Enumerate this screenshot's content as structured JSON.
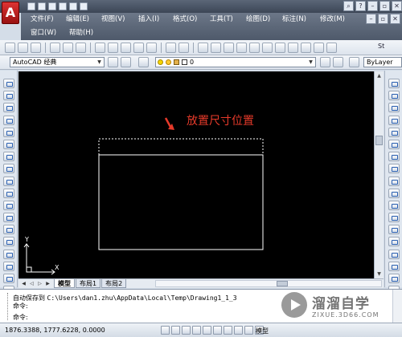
{
  "app": {
    "logo_letter": "A"
  },
  "menubar": {
    "row1": [
      "文件(F)",
      "编辑(E)",
      "视图(V)",
      "插入(I)",
      "格式(O)",
      "工具(T)",
      "绘图(D)",
      "标注(N)",
      "修改(M)"
    ],
    "row2": [
      "窗口(W)",
      "帮助(H)"
    ]
  },
  "toolbar": {
    "workspace": "AutoCAD 经典",
    "layer": "0",
    "linetype_combo": "ByLayer",
    "text_style_label": "St"
  },
  "annotation": {
    "text": "放置尺寸位置",
    "color": "#e63a2a"
  },
  "tabs": [
    "模型",
    "布局1",
    "布局2"
  ],
  "active_tab": "模型",
  "command": {
    "line1_prefix": "自动保存到",
    "line1_path": "C:\\Users\\dan1.zhu\\AppData\\Local\\Temp\\Drawing1_1_3",
    "line2": "命令:",
    "line3": "命令:"
  },
  "statusbar": {
    "coords": "1876.3388, 1777.6228, 0.0000",
    "model_label": "模型"
  },
  "ucs": {
    "x_label": "X",
    "y_label": "Y"
  },
  "watermark": {
    "name": "溜溜自学",
    "url": "ZIXUE.3D66.COM"
  }
}
